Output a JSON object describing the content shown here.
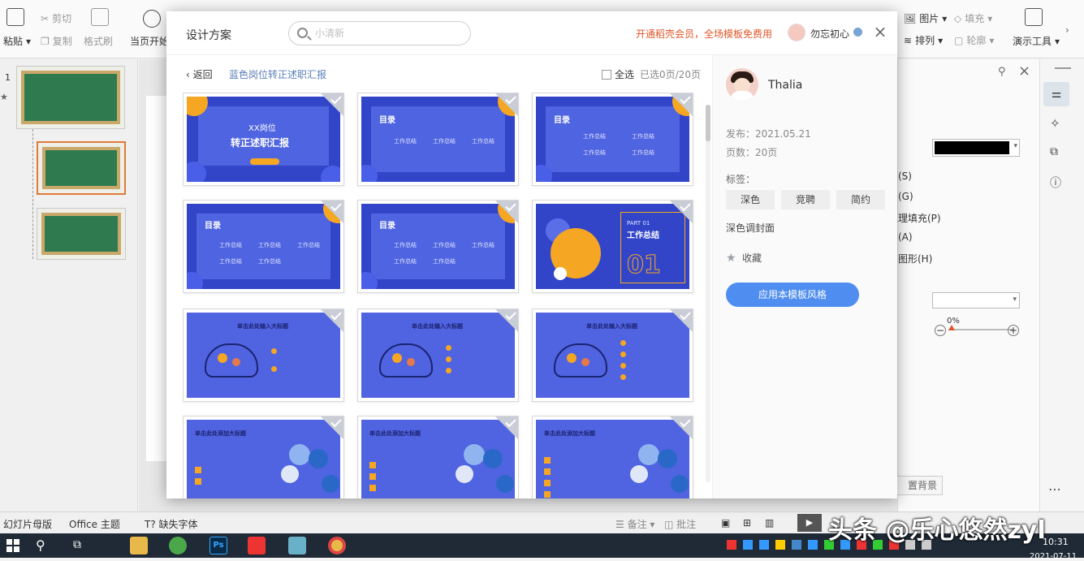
{
  "ribbon": {
    "paste": "粘贴",
    "cut": "剪切",
    "copy": "复制",
    "format_painter": "格式刷",
    "from_current": "当页开始",
    "picture": "图片",
    "fill": "填充",
    "arrange": "排列",
    "outline": "轮廓",
    "presentation_tools": "演示工具"
  },
  "dialog": {
    "title": "设计方案",
    "search_placeholder": "小清新",
    "promo": "开通稻壳会员，全场模板免费用",
    "username": "勿忘初心",
    "back": "返回",
    "template_name": "蓝色岗位转正述职汇报",
    "select_all": "全选",
    "selected_count": "已选0页/20页"
  },
  "slides": {
    "cover_title_1": "XX岗位",
    "cover_title_2": "转正述职汇报",
    "toc": "目录",
    "work_summary": "工作总结",
    "part": "PART 01",
    "part_title": "工作总结",
    "part_num": "01",
    "big_title_1": "单击此处输入大标题",
    "big_title_2": "单击此处添加大标题"
  },
  "detail": {
    "author": "Thalia",
    "publish_label": "发布：",
    "publish_date": "2021.05.21",
    "pages_label": "页数：",
    "pages": "20页",
    "tags_label": "标签：",
    "tags": [
      "深色",
      "竞聘",
      "简约"
    ],
    "extra_tag": "深色调封面",
    "favorite": "收藏",
    "apply": "应用本模板风格"
  },
  "rightpane": {
    "s": "(S)",
    "g": "(G)",
    "fill_p": "理填充(P)",
    "a": "(A)",
    "shape_h": "图形(H)",
    "percent": "0%",
    "bg": "置背景"
  },
  "status": {
    "master": "幻灯片母版",
    "office_theme": "Office 主题",
    "missing_font": "缺失字体",
    "notes": "备注",
    "comments": "批注"
  },
  "overlay": {
    "watermark": "头条 @乐心悠然zyl",
    "clock": "10:31",
    "date": "2021-07-11"
  },
  "colors": {
    "accent": "#4f8ef0",
    "promo": "#e0562a",
    "slide_blue": "#3245c8",
    "slide_orange": "#f5a623"
  }
}
